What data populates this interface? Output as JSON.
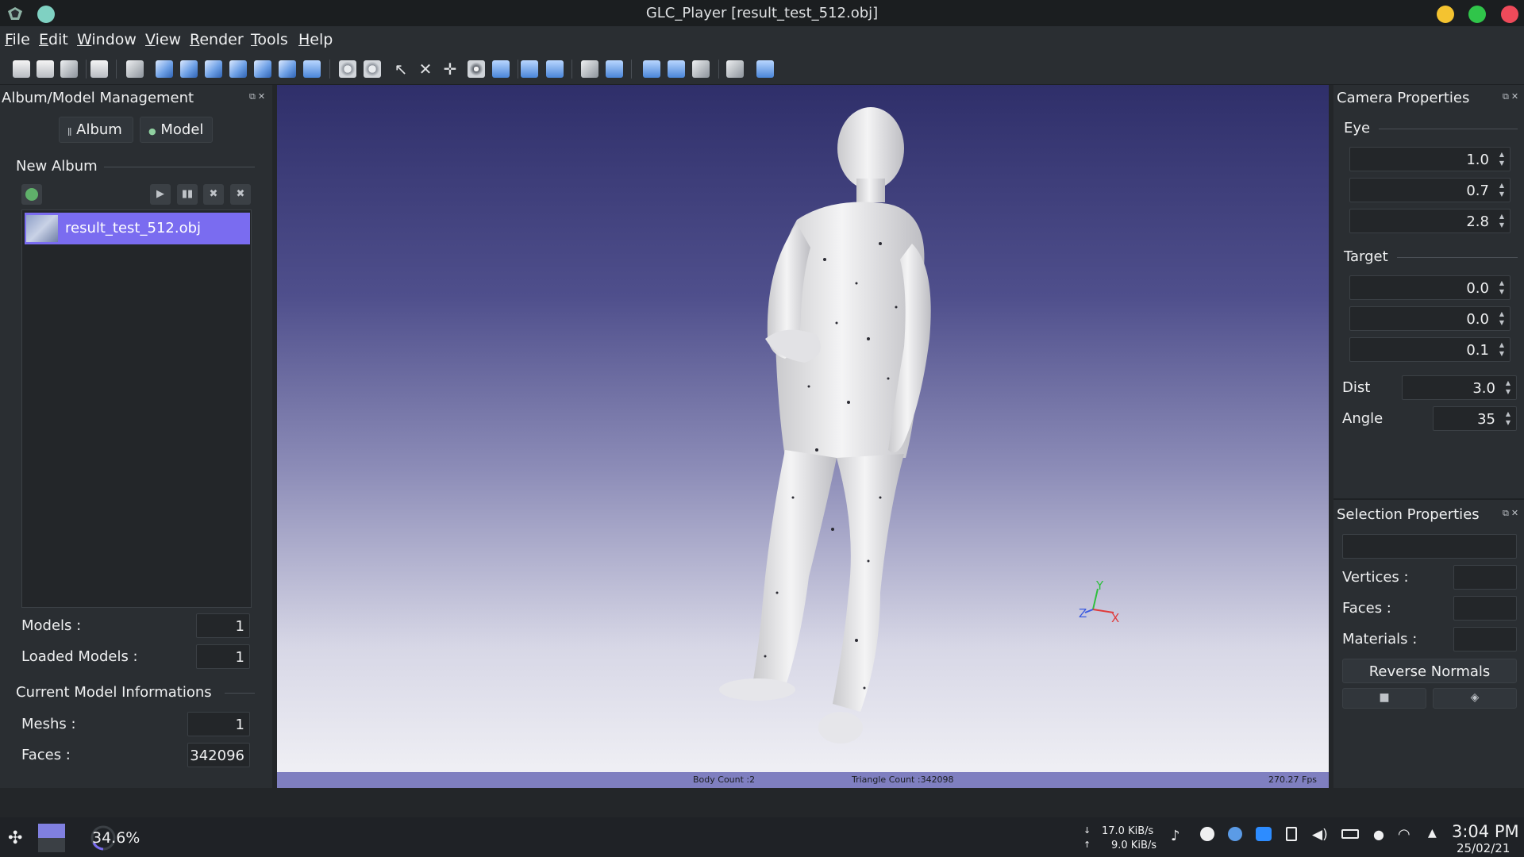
{
  "window": {
    "title": "GLC_Player [result_test_512.obj]"
  },
  "menu": [
    "File",
    "Edit",
    "Window",
    "View",
    "Render",
    "Tools",
    "Help"
  ],
  "left_panel": {
    "title": "Album/Model Management",
    "tabs": [
      "Album",
      "Model"
    ],
    "album_label": "New Album",
    "list_items": [
      "result_test_512.obj"
    ],
    "models_label": "Models :",
    "models_value": "1",
    "loaded_label": "Loaded Models :",
    "loaded_value": "1",
    "current_label": "Current Model Informations",
    "meshs_label": "Meshs :",
    "meshs_value": "1",
    "faces_label": "Faces :",
    "faces_value": "342096"
  },
  "viewport": {
    "body_count": "Body Count :2",
    "triangle_count": "Triangle Count :342098",
    "fps": "270.27 Fps",
    "axis_y": "Y",
    "axis_z": "Z",
    "axis_x": "X"
  },
  "camera": {
    "title": "Camera Properties",
    "eye_label": "Eye",
    "eye": [
      "1.0",
      "0.7",
      "2.8"
    ],
    "target_label": "Target",
    "target": [
      "0.0",
      "0.0",
      "0.1"
    ],
    "dist_label": "Dist",
    "dist": "3.0",
    "angle_label": "Angle",
    "angle": "35"
  },
  "selection": {
    "title": "Selection Properties",
    "vertices_label": "Vertices :",
    "faces_label": "Faces :",
    "materials_label": "Materials :",
    "reverse_label": "Reverse Normals"
  },
  "taskbar": {
    "cpu": "34.6%",
    "net_down": "17.0 KiB/s",
    "net_up": "9.0 KiB/s",
    "time": "3:04 PM",
    "date": "25/02/21"
  },
  "colors": {
    "accent": "#7a6cf0",
    "close": "#ef4a5a",
    "minimize": "#f4c330",
    "maximize": "#30c54a"
  }
}
